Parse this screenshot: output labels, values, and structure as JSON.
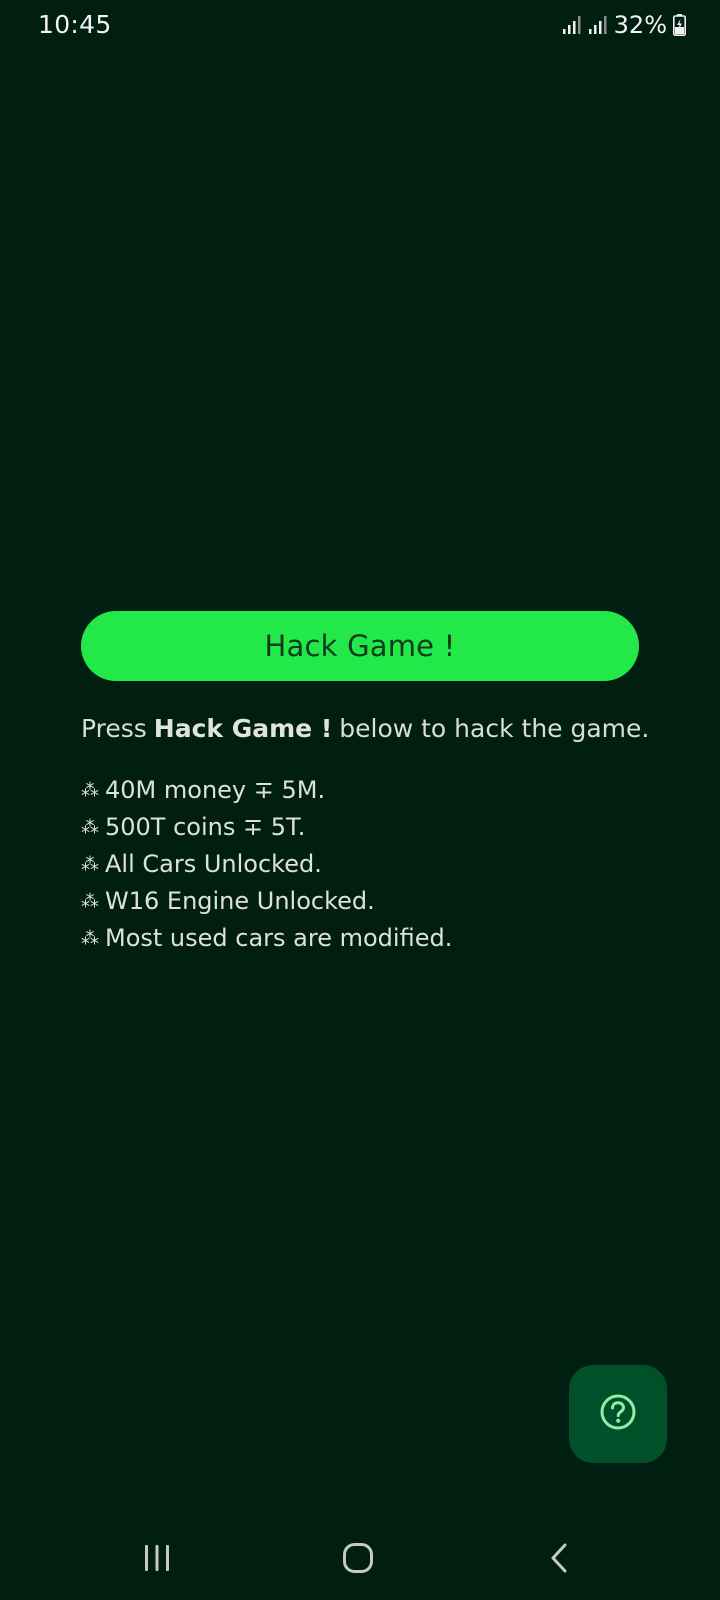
{
  "status_bar": {
    "time": "10:45",
    "battery_percent": "32%",
    "icons": [
      "signal-icon",
      "signal-icon",
      "battery-charging-icon"
    ]
  },
  "main": {
    "hack_button_label": "Hack Game !",
    "instruction_prefix": "Press",
    "instruction_strong": "Hack Game !",
    "instruction_suffix": "below to hack the game.",
    "bullet_symbol": "⁂",
    "features": [
      "40M money ∓ 5M.",
      "500T coins ∓ 5T.",
      "All Cars Unlocked.",
      "W16 Engine Unlocked.",
      "Most used cars are modified."
    ]
  },
  "fab": {
    "icon": "help-icon"
  },
  "nav_bar": {
    "icons": [
      "recents-icon",
      "home-icon",
      "back-icon"
    ]
  },
  "colors": {
    "background": "#001f11",
    "button": "#23e84a",
    "button_text": "#0f3a1e",
    "fab": "#02502a",
    "fab_icon": "#8ff0a4"
  }
}
